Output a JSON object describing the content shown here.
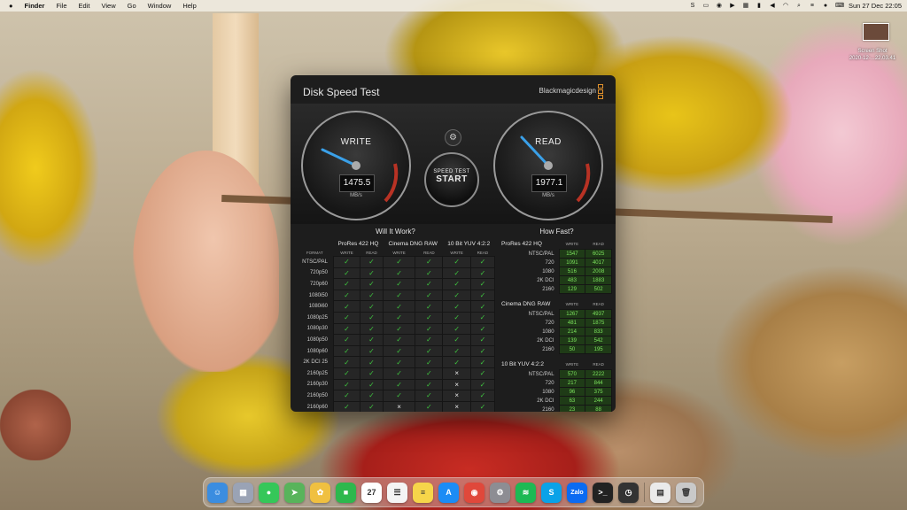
{
  "menubar": {
    "apple": "",
    "items": [
      "Finder",
      "File",
      "Edit",
      "View",
      "Go",
      "Window",
      "Help"
    ],
    "clock": "Sun 27 Dec  22:05"
  },
  "desktop": {
    "thumb_label_1": "Screen Shot",
    "thumb_label_2": "2020-12-...22.03.41"
  },
  "app": {
    "title": "Disk Speed Test",
    "brand": "Blackmagicdesign",
    "write": {
      "label": "WRITE",
      "value": "1475.5",
      "unit": "MB/s"
    },
    "read": {
      "label": "READ",
      "value": "1977.1",
      "unit": "MB/s"
    },
    "start_small": "SPEED TEST",
    "start_big": "START",
    "settings_icon": "gear-icon",
    "accent": "#3ec33e"
  },
  "will": {
    "title": "Will It Work?",
    "groups": [
      "ProRes 422 HQ",
      "Cinema DNG RAW",
      "10 Bit YUV 4:2:2"
    ],
    "sub": [
      "FORMAT",
      "WRITE",
      "READ",
      "WRITE",
      "READ",
      "WRITE",
      "READ"
    ],
    "rows": [
      {
        "fmt": "NTSC/PAL",
        "c": [
          "✓",
          "✓",
          "✓",
          "✓",
          "✓",
          "✓"
        ]
      },
      {
        "fmt": "720p50",
        "c": [
          "✓",
          "✓",
          "✓",
          "✓",
          "✓",
          "✓"
        ]
      },
      {
        "fmt": "720p60",
        "c": [
          "✓",
          "✓",
          "✓",
          "✓",
          "✓",
          "✓"
        ]
      },
      {
        "fmt": "1080i50",
        "c": [
          "✓",
          "✓",
          "✓",
          "✓",
          "✓",
          "✓"
        ]
      },
      {
        "fmt": "1080i60",
        "c": [
          "✓",
          "✓",
          "✓",
          "✓",
          "✓",
          "✓"
        ]
      },
      {
        "fmt": "1080p25",
        "c": [
          "✓",
          "✓",
          "✓",
          "✓",
          "✓",
          "✓"
        ]
      },
      {
        "fmt": "1080p30",
        "c": [
          "✓",
          "✓",
          "✓",
          "✓",
          "✓",
          "✓"
        ]
      },
      {
        "fmt": "1080p50",
        "c": [
          "✓",
          "✓",
          "✓",
          "✓",
          "✓",
          "✓"
        ]
      },
      {
        "fmt": "1080p60",
        "c": [
          "✓",
          "✓",
          "✓",
          "✓",
          "✓",
          "✓"
        ]
      },
      {
        "fmt": "2K DCI 25",
        "c": [
          "✓",
          "✓",
          "✓",
          "✓",
          "✓",
          "✓"
        ]
      },
      {
        "fmt": "2160p25",
        "c": [
          "✓",
          "✓",
          "✓",
          "✓",
          "×",
          "✓"
        ]
      },
      {
        "fmt": "2160p30",
        "c": [
          "✓",
          "✓",
          "✓",
          "✓",
          "×",
          "✓"
        ]
      },
      {
        "fmt": "2160p50",
        "c": [
          "✓",
          "✓",
          "✓",
          "✓",
          "×",
          "✓"
        ]
      },
      {
        "fmt": "2160p60",
        "c": [
          "✓",
          "✓",
          "×",
          "✓",
          "×",
          "✓"
        ]
      }
    ]
  },
  "how": {
    "title": "How Fast?",
    "sections": [
      {
        "name": "ProRes 422 HQ",
        "rows": [
          {
            "f": "NTSC/PAL",
            "w": "1547",
            "r": "6025"
          },
          {
            "f": "720",
            "w": "1091",
            "r": "4017"
          },
          {
            "f": "1080",
            "w": "516",
            "r": "2008"
          },
          {
            "f": "2K DCI",
            "w": "483",
            "r": "1883"
          },
          {
            "f": "2160",
            "w": "129",
            "r": "502"
          }
        ]
      },
      {
        "name": "Cinema DNG RAW",
        "rows": [
          {
            "f": "NTSC/PAL",
            "w": "1267",
            "r": "4937"
          },
          {
            "f": "720",
            "w": "481",
            "r": "1875"
          },
          {
            "f": "1080",
            "w": "214",
            "r": "833"
          },
          {
            "f": "2K DCI",
            "w": "139",
            "r": "542"
          },
          {
            "f": "2160",
            "w": "50",
            "r": "195"
          }
        ]
      },
      {
        "name": "10 Bit YUV 4:2:2",
        "rows": [
          {
            "f": "NTSC/PAL",
            "w": "570",
            "r": "2222"
          },
          {
            "f": "720",
            "w": "217",
            "r": "844"
          },
          {
            "f": "1080",
            "w": "96",
            "r": "375"
          },
          {
            "f": "2K DCI",
            "w": "63",
            "r": "244"
          },
          {
            "f": "2160",
            "w": "23",
            "r": "88"
          }
        ]
      }
    ],
    "col_write": "WRITE",
    "col_read": "READ"
  },
  "dock": {
    "apps": [
      {
        "name": "finder",
        "color": "#3b8de0",
        "glyph": "☺"
      },
      {
        "name": "launchpad",
        "color": "#9aa3b5",
        "glyph": "▦"
      },
      {
        "name": "messages",
        "color": "#35c759",
        "glyph": "●"
      },
      {
        "name": "maps",
        "color": "#58b45b",
        "glyph": "➤"
      },
      {
        "name": "photos",
        "color": "#f0c040",
        "glyph": "✿"
      },
      {
        "name": "facetime",
        "color": "#2db84d",
        "glyph": "■"
      },
      {
        "name": "calendar",
        "color": "#ffffff",
        "glyph": "27"
      },
      {
        "name": "reminders",
        "color": "#f4f4f4",
        "glyph": "☰"
      },
      {
        "name": "notes",
        "color": "#f6d54a",
        "glyph": "≡"
      },
      {
        "name": "app-store",
        "color": "#1c8cf5",
        "glyph": "A"
      },
      {
        "name": "chrome",
        "color": "#e0483b",
        "glyph": "◉"
      },
      {
        "name": "system-preferences",
        "color": "#8d8d93",
        "glyph": "⚙"
      },
      {
        "name": "spotify",
        "color": "#1db954",
        "glyph": "≋"
      },
      {
        "name": "skype",
        "color": "#0aa2e8",
        "glyph": "S"
      },
      {
        "name": "zalo",
        "color": "#0b6bf2",
        "glyph": "Zalo"
      },
      {
        "name": "terminal",
        "color": "#222222",
        "glyph": ">_"
      },
      {
        "name": "disk-speed-test",
        "color": "#333333",
        "glyph": "◷"
      },
      {
        "name": "document",
        "color": "#eaeaea",
        "glyph": "▤"
      },
      {
        "name": "trash",
        "color": "#c9c9c9",
        "glyph": "🗑"
      }
    ]
  }
}
